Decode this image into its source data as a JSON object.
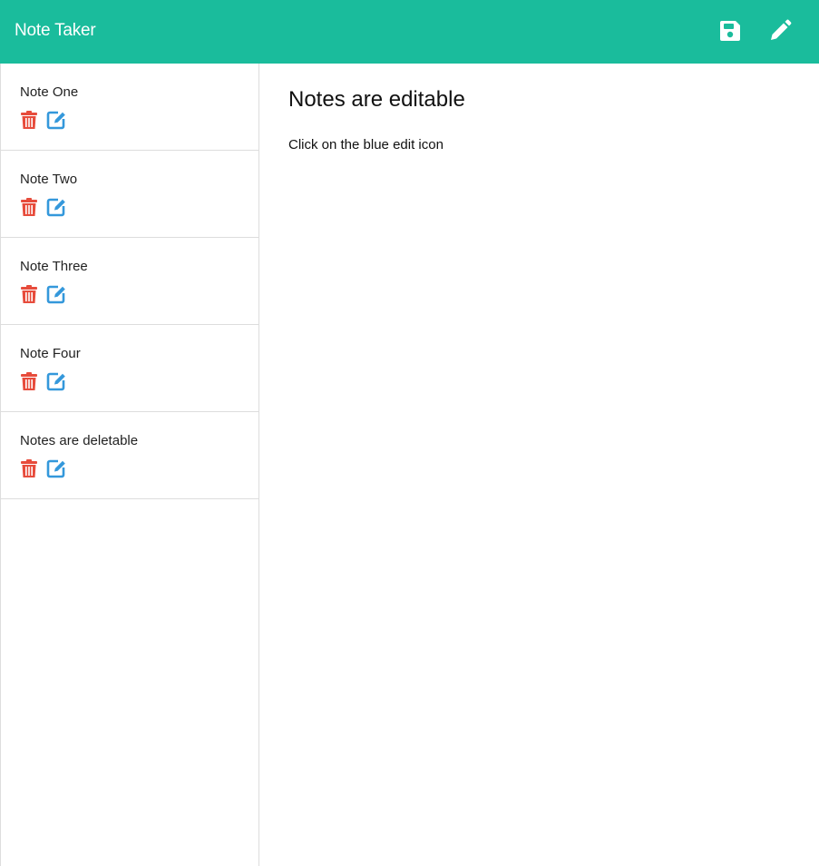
{
  "header": {
    "title": "Note Taker",
    "save_icon": "floppy-disk-icon",
    "new_note_icon": "pencil-icon",
    "background_color": "#1abc9c"
  },
  "sidebar": {
    "notes": [
      {
        "title": "Note One"
      },
      {
        "title": "Note Two"
      },
      {
        "title": "Note Three"
      },
      {
        "title": "Note Four"
      },
      {
        "title": "Notes are deletable"
      }
    ],
    "delete_icon": "trash-icon",
    "edit_icon": "edit-icon",
    "delete_color": "#e74c3c",
    "edit_color": "#3498db"
  },
  "main": {
    "title": "Notes are editable",
    "body": "Click on the blue edit icon"
  }
}
